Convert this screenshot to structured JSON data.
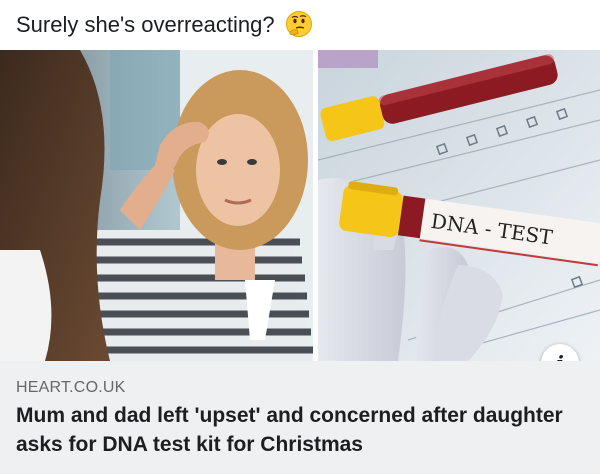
{
  "post": {
    "text": "Surely she's overreacting?",
    "emoji": "thinking-face"
  },
  "images": {
    "left_alt": "woman-with-hand-on-forehead",
    "right_alt": "dna-test-blood-vial",
    "vial_label": "DNA - TEST"
  },
  "link": {
    "domain": "HEART.CO.UK",
    "headline": "Mum and dad left 'upset' and concerned after daughter asks for DNA test kit for Christmas",
    "info_icon_glyph": "i"
  },
  "colors": {
    "link_background": "#eef0f2",
    "headline": "#1c1e21",
    "domain": "#65676b",
    "vial_cap": "#f5c518",
    "blood": "#8b1a22"
  }
}
